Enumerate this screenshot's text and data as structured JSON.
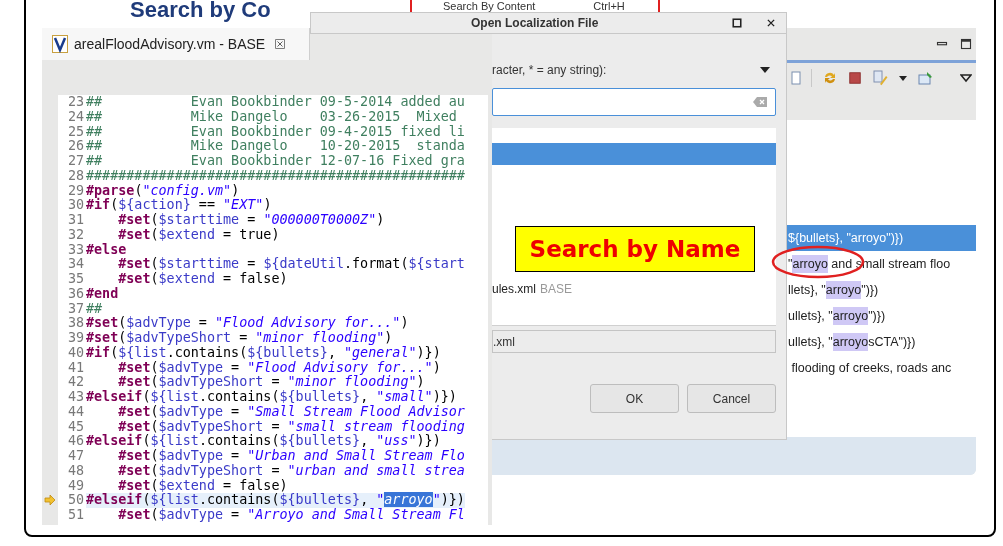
{
  "slide": {
    "title_fragment": "Search by Co"
  },
  "menu_popup": {
    "item": "Search By Content",
    "shortcut": "Ctrl+H"
  },
  "dialog": {
    "title": "Open Localization File",
    "filter_label": "racter, * = any string):",
    "results": [
      {
        "selected": true
      },
      {
        "selected": false,
        "name": "ules.xml",
        "source": "BASE"
      }
    ],
    "selected_path": ".xml",
    "buttons": [
      "OK",
      "Cancel"
    ]
  },
  "editor": {
    "tab": {
      "title": "arealFloodAdvisory.vm - BASE"
    },
    "lines": [
      {
        "number": "23",
        "current": false,
        "tokens": [
          {
            "kind": "comment",
            "text": "##           Evan Bookbinder 09-5-2014 added au"
          }
        ]
      },
      {
        "number": "24",
        "current": false,
        "tokens": [
          {
            "kind": "comment",
            "text": "##           Mike Dangelo    03-26-2015  Mixed"
          }
        ]
      },
      {
        "number": "25",
        "current": false,
        "tokens": [
          {
            "kind": "comment",
            "text": "##           Evan Bookbinder 09-4-2015 fixed li"
          }
        ]
      },
      {
        "number": "26",
        "current": false,
        "tokens": [
          {
            "kind": "comment",
            "text": "##           Mike Dangelo    10-20-2015  standa"
          }
        ]
      },
      {
        "number": "27",
        "current": false,
        "tokens": [
          {
            "kind": "comment",
            "text": "##           Evan Bookbinder 12-07-16 Fixed gra"
          }
        ]
      },
      {
        "number": "28",
        "current": false,
        "tokens": [
          {
            "kind": "comment",
            "text": "###############################################"
          }
        ]
      },
      {
        "number": "29",
        "current": false,
        "tokens": [
          {
            "kind": "directive",
            "text": "#parse"
          },
          {
            "kind": "plain",
            "text": "("
          },
          {
            "kind": "string",
            "text": "\"config.vm\""
          },
          {
            "kind": "plain",
            "text": ")"
          }
        ]
      },
      {
        "number": "30",
        "current": false,
        "tokens": [
          {
            "kind": "directive",
            "text": "#if"
          },
          {
            "kind": "plain",
            "text": "("
          },
          {
            "kind": "variable",
            "text": "${action}"
          },
          {
            "kind": "plain",
            "text": " == "
          },
          {
            "kind": "string",
            "text": "\"EXT\""
          },
          {
            "kind": "plain",
            "text": ")"
          }
        ]
      },
      {
        "number": "31",
        "current": false,
        "tokens": [
          {
            "kind": "directive",
            "text": "    #set"
          },
          {
            "kind": "plain",
            "text": "("
          },
          {
            "kind": "variable",
            "text": "$starttime"
          },
          {
            "kind": "plain",
            "text": " = "
          },
          {
            "kind": "string",
            "text": "\"000000T0000Z\""
          },
          {
            "kind": "plain",
            "text": ")"
          }
        ]
      },
      {
        "number": "32",
        "current": false,
        "tokens": [
          {
            "kind": "directive",
            "text": "    #set"
          },
          {
            "kind": "plain",
            "text": "("
          },
          {
            "kind": "variable",
            "text": "$extend"
          },
          {
            "kind": "plain",
            "text": " = true)"
          }
        ]
      },
      {
        "number": "33",
        "current": false,
        "tokens": [
          {
            "kind": "directive",
            "text": "#else"
          }
        ]
      },
      {
        "number": "34",
        "current": false,
        "tokens": [
          {
            "kind": "directive",
            "text": "    #set"
          },
          {
            "kind": "plain",
            "text": "("
          },
          {
            "kind": "variable",
            "text": "$starttime"
          },
          {
            "kind": "plain",
            "text": " = "
          },
          {
            "kind": "variable",
            "text": "${dateUtil"
          },
          {
            "kind": "plain",
            "text": ".format("
          },
          {
            "kind": "variable",
            "text": "${start"
          }
        ]
      },
      {
        "number": "35",
        "current": false,
        "tokens": [
          {
            "kind": "directive",
            "text": "    #set"
          },
          {
            "kind": "plain",
            "text": "("
          },
          {
            "kind": "variable",
            "text": "$extend"
          },
          {
            "kind": "plain",
            "text": " = false)"
          }
        ]
      },
      {
        "number": "36",
        "current": false,
        "tokens": [
          {
            "kind": "directive",
            "text": "#end"
          }
        ]
      },
      {
        "number": "37",
        "current": false,
        "tokens": [
          {
            "kind": "comment",
            "text": "##"
          }
        ]
      },
      {
        "number": "38",
        "current": false,
        "tokens": [
          {
            "kind": "directive",
            "text": "#set"
          },
          {
            "kind": "plain",
            "text": "("
          },
          {
            "kind": "variable",
            "text": "$advType"
          },
          {
            "kind": "plain",
            "text": " = "
          },
          {
            "kind": "string",
            "text": "\"Flood Advisory for...\""
          },
          {
            "kind": "plain",
            "text": ")"
          }
        ]
      },
      {
        "number": "39",
        "current": false,
        "tokens": [
          {
            "kind": "directive",
            "text": "#set"
          },
          {
            "kind": "plain",
            "text": "("
          },
          {
            "kind": "variable",
            "text": "$advTypeShort"
          },
          {
            "kind": "plain",
            "text": " = "
          },
          {
            "kind": "string",
            "text": "\"minor flooding\""
          },
          {
            "kind": "plain",
            "text": ")"
          }
        ]
      },
      {
        "number": "40",
        "current": false,
        "tokens": [
          {
            "kind": "directive",
            "text": "#if"
          },
          {
            "kind": "plain",
            "text": "("
          },
          {
            "kind": "variable",
            "text": "${list"
          },
          {
            "kind": "plain",
            "text": ".contains("
          },
          {
            "kind": "variable",
            "text": "${bullets}"
          },
          {
            "kind": "plain",
            "text": ", "
          },
          {
            "kind": "string",
            "text": "\"general\""
          },
          {
            "kind": "plain",
            "text": ")})"
          }
        ]
      },
      {
        "number": "41",
        "current": false,
        "tokens": [
          {
            "kind": "directive",
            "text": "    #set"
          },
          {
            "kind": "plain",
            "text": "("
          },
          {
            "kind": "variable",
            "text": "$advType"
          },
          {
            "kind": "plain",
            "text": " = "
          },
          {
            "kind": "string",
            "text": "\"Flood Advisory for...\""
          },
          {
            "kind": "plain",
            "text": ")"
          }
        ]
      },
      {
        "number": "42",
        "current": false,
        "tokens": [
          {
            "kind": "directive",
            "text": "    #set"
          },
          {
            "kind": "plain",
            "text": "("
          },
          {
            "kind": "variable",
            "text": "$advTypeShort"
          },
          {
            "kind": "plain",
            "text": " = "
          },
          {
            "kind": "string",
            "text": "\"minor flooding\""
          },
          {
            "kind": "plain",
            "text": ")"
          }
        ]
      },
      {
        "number": "43",
        "current": false,
        "tokens": [
          {
            "kind": "directive",
            "text": "#elseif"
          },
          {
            "kind": "plain",
            "text": "("
          },
          {
            "kind": "variable",
            "text": "${list"
          },
          {
            "kind": "plain",
            "text": ".contains("
          },
          {
            "kind": "variable",
            "text": "${bullets}"
          },
          {
            "kind": "plain",
            "text": ", "
          },
          {
            "kind": "string",
            "text": "\"small\""
          },
          {
            "kind": "plain",
            "text": ")})"
          }
        ]
      },
      {
        "number": "44",
        "current": false,
        "tokens": [
          {
            "kind": "directive",
            "text": "    #set"
          },
          {
            "kind": "plain",
            "text": "("
          },
          {
            "kind": "variable",
            "text": "$advType"
          },
          {
            "kind": "plain",
            "text": " = "
          },
          {
            "kind": "string",
            "text": "\"Small Stream Flood Advisor"
          }
        ]
      },
      {
        "number": "45",
        "current": false,
        "tokens": [
          {
            "kind": "directive",
            "text": "    #set"
          },
          {
            "kind": "plain",
            "text": "("
          },
          {
            "kind": "variable",
            "text": "$advTypeShort"
          },
          {
            "kind": "plain",
            "text": " = "
          },
          {
            "kind": "string",
            "text": "\"small stream flooding"
          }
        ]
      },
      {
        "number": "46",
        "current": false,
        "tokens": [
          {
            "kind": "directive",
            "text": "#elseif"
          },
          {
            "kind": "plain",
            "text": "("
          },
          {
            "kind": "variable",
            "text": "${list"
          },
          {
            "kind": "plain",
            "text": ".contains("
          },
          {
            "kind": "variable",
            "text": "${bullets}"
          },
          {
            "kind": "plain",
            "text": ", "
          },
          {
            "kind": "string",
            "text": "\"uss\""
          },
          {
            "kind": "plain",
            "text": ")})"
          }
        ]
      },
      {
        "number": "47",
        "current": false,
        "tokens": [
          {
            "kind": "directive",
            "text": "    #set"
          },
          {
            "kind": "plain",
            "text": "("
          },
          {
            "kind": "variable",
            "text": "$advType"
          },
          {
            "kind": "plain",
            "text": " = "
          },
          {
            "kind": "string",
            "text": "\"Urban and Small Stream Flo"
          }
        ]
      },
      {
        "number": "48",
        "current": false,
        "tokens": [
          {
            "kind": "directive",
            "text": "    #set"
          },
          {
            "kind": "plain",
            "text": "("
          },
          {
            "kind": "variable",
            "text": "$advTypeShort"
          },
          {
            "kind": "plain",
            "text": " = "
          },
          {
            "kind": "string",
            "text": "\"urban and small strea"
          }
        ]
      },
      {
        "number": "49",
        "current": false,
        "tokens": [
          {
            "kind": "directive",
            "text": "    #set"
          },
          {
            "kind": "plain",
            "text": "("
          },
          {
            "kind": "variable",
            "text": "$extend"
          },
          {
            "kind": "plain",
            "text": " = false)"
          }
        ]
      },
      {
        "number": "50",
        "current": true,
        "tokens": [
          {
            "kind": "directive",
            "text": "#elseif"
          },
          {
            "kind": "plain",
            "text": "("
          },
          {
            "kind": "variable",
            "text": "${list"
          },
          {
            "kind": "plain",
            "text": ".contains("
          },
          {
            "kind": "variable",
            "text": "${bullets}"
          },
          {
            "kind": "plain",
            "text": ", "
          },
          {
            "kind": "string",
            "text": "\""
          },
          {
            "kind": "selection",
            "text": "arroyo"
          },
          {
            "kind": "string",
            "text": "\""
          },
          {
            "kind": "plain",
            "text": ")})"
          }
        ]
      },
      {
        "number": "51",
        "current": false,
        "tokens": [
          {
            "kind": "directive",
            "text": "    #set"
          },
          {
            "kind": "plain",
            "text": "("
          },
          {
            "kind": "variable",
            "text": "$advType"
          },
          {
            "kind": "plain",
            "text": " = "
          },
          {
            "kind": "string",
            "text": "\"Arroyo and Small Stream Fl"
          }
        ]
      }
    ]
  },
  "search_results": {
    "rows": [
      {
        "selected": true,
        "tokens": [
          {
            "kind": "plain",
            "text": "${bullets}, \"arroyo\")})"
          }
        ]
      },
      {
        "selected": false,
        "tokens": [
          {
            "kind": "plain",
            "text": "\""
          },
          {
            "kind": "match",
            "text": "arroyo"
          },
          {
            "kind": "plain",
            "text": " and small stream floo"
          }
        ]
      },
      {
        "selected": false,
        "tokens": [
          {
            "kind": "plain",
            "text": "llets}, \""
          },
          {
            "kind": "match",
            "text": "arroyo"
          },
          {
            "kind": "plain",
            "text": "\")})"
          }
        ]
      },
      {
        "selected": false,
        "tokens": [
          {
            "kind": "plain",
            "text": "ullets}, \""
          },
          {
            "kind": "match",
            "text": "arroyo"
          },
          {
            "kind": "plain",
            "text": "\")})"
          }
        ]
      },
      {
        "selected": false,
        "tokens": [
          {
            "kind": "plain",
            "text": "ullets}, \""
          },
          {
            "kind": "match",
            "text": "arroyo"
          },
          {
            "kind": "plain",
            "text": "sCTA\")})"
          }
        ]
      },
      {
        "selected": false,
        "tokens": [
          {
            "kind": "plain",
            "text": " flooding of creeks, roads anc"
          }
        ]
      }
    ]
  },
  "callout": {
    "text": "Search by Name"
  }
}
